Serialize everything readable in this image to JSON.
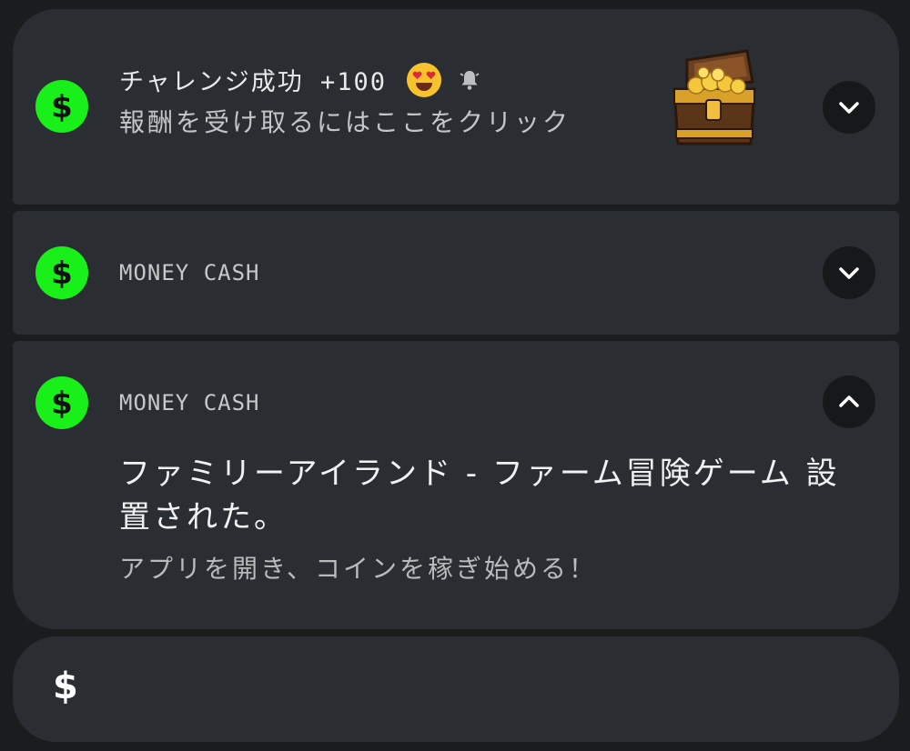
{
  "notifications": [
    {
      "app_icon": "dollar-icon",
      "title": "チャレンジ成功 +100",
      "subtitle": "報酬を受け取るにはここをクリック",
      "emoji": "heart-eyes-emoji",
      "status_icon": "bell-icon",
      "image": "treasure-chest",
      "toggle_icon": "chevron-down-icon"
    },
    {
      "app_icon": "dollar-icon",
      "app_name": "MONEY CASH",
      "toggle_icon": "chevron-down-icon"
    },
    {
      "app_icon": "dollar-icon",
      "app_name": "MONEY CASH",
      "toggle_icon": "chevron-up-icon",
      "title": "ファミリーアイランド - ファーム冒険ゲーム 設置された。",
      "body": "アプリを開き、コインを稼ぎ始める！"
    },
    {
      "glyph": "$"
    }
  ],
  "colors": {
    "icon_green": "#19f01a",
    "card_bg": "#2a2d31",
    "screen_bg": "#1a1c1e",
    "button_bg": "#161819"
  }
}
